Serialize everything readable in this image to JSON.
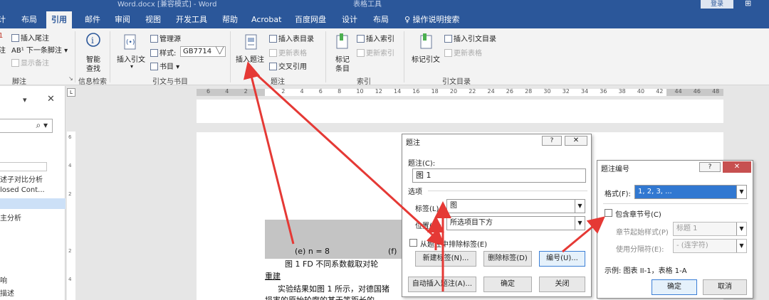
{
  "window": {
    "doc_title": "Word.docx [兼容模式] - Word",
    "table_tools": "表格工具",
    "login": "登录",
    "share_icon": "share-icon"
  },
  "tabs": [
    "计",
    "布局",
    "引用",
    "邮件",
    "审阅",
    "视图",
    "开发工具",
    "帮助",
    "Acrobat",
    "百度网盘",
    "设计",
    "布局",
    "操作说明搜索"
  ],
  "ribbon": {
    "footnote": {
      "insert_endnote": "插入尾注",
      "next_footnote": "下一条脚注",
      "show_notes": "显示备注",
      "partial_left": "注",
      "group": "脚注"
    },
    "research": {
      "smart_lookup": "智能",
      "smart_lookup2": "查找",
      "group": "信息检索"
    },
    "citations": {
      "insert_citation": "插入引文",
      "manage_sources": "管理源",
      "style_label": "样式:",
      "style_value": "GB7714",
      "bibliography": "书目",
      "group": "引文与书目"
    },
    "captions": {
      "insert_caption": "插入题注",
      "insert_table_of_figures": "插入表目录",
      "update_table": "更新表格",
      "cross_reference": "交叉引用",
      "group": "题注"
    },
    "index": {
      "mark_entry": "标记",
      "mark_entry2": "条目",
      "insert_index": "插入索引",
      "update_index": "更新索引",
      "group": "索引"
    },
    "toa": {
      "mark_citation": "标记引文",
      "insert_toa": "插入引文目录",
      "update_toa": "更新表格",
      "group": "引文目录"
    }
  },
  "nav": {
    "search_icon": "search-icon",
    "items": [
      "述子对比分析",
      "losed Cont...",
      "",
      "主分析",
      "响",
      "描述"
    ]
  },
  "ruler": {
    "ticks": [
      "6",
      "4",
      "2",
      "",
      "2",
      "4",
      "6",
      "8",
      "10",
      "12",
      "14",
      "16",
      "18",
      "20",
      "22",
      "24",
      "26",
      "28",
      "30",
      "32",
      "34",
      "36",
      "38",
      "40",
      "42",
      "44",
      "46",
      "48"
    ],
    "vticks": [
      "6",
      "4",
      "2",
      "",
      "2",
      "4"
    ]
  },
  "document": {
    "subfig_e": "(e)  n = 8",
    "subfig_f": "(f)",
    "caption_line": "图 1   FD 不同系数截取对轮",
    "caption_line2": "重建",
    "body1": "实验结果如图 1 所示，对德国猪",
    "body2": "损害的原始轮廓的某于等距长的"
  },
  "caption_dialog": {
    "title": "题注",
    "help": "?",
    "caption_label": "题注(C):",
    "caption_value": "图  1",
    "options": "选项",
    "label_label": "标签(L):",
    "label_value": "图",
    "position_label": "位置(P):",
    "position_value": "所选项目下方",
    "exclude_label": "从题注中排除标签(E)",
    "new_label": "新建标签(N)...",
    "delete_label": "删除标签(D)",
    "numbering": "编号(U)...",
    "auto_caption": "自动插入题注(A)...",
    "ok": "确定",
    "close": "关闭"
  },
  "numbering_dialog": {
    "title": "题注编号",
    "help": "?",
    "format_label": "格式(F):",
    "format_value": "1, 2, 3, ...",
    "include_chapter": "包含章节号(C)",
    "chapter_style_label": "章节起始样式(P)",
    "chapter_style_value": "标题 1",
    "separator_label": "使用分隔符(E):",
    "separator_value": "-   (连字符)",
    "example": "示例: 图表 II-1，表格 1-A",
    "ok": "确定",
    "cancel": "取消"
  }
}
